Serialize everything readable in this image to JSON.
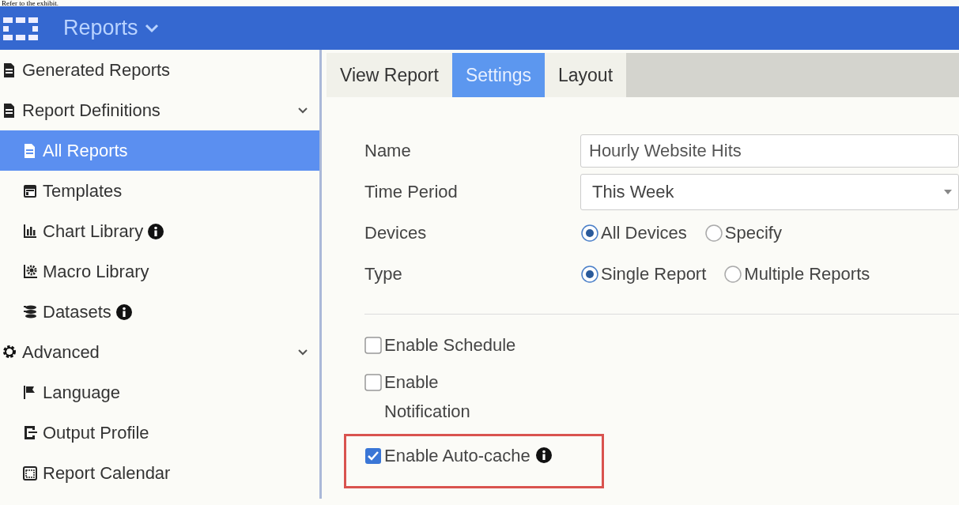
{
  "caption": "Refer to the exhibit.",
  "header": {
    "title": "Reports"
  },
  "sidebar": {
    "items": [
      {
        "label": "Generated Reports",
        "kind": "doc",
        "info": false,
        "selected": false
      },
      {
        "label": "Report Definitions",
        "kind": "doc",
        "info": false,
        "selected": false,
        "expanded": true,
        "children": [
          {
            "label": "All Reports",
            "kind": "report",
            "info": false,
            "selected": true
          },
          {
            "label": "Templates",
            "kind": "template",
            "info": false,
            "selected": false
          },
          {
            "label": "Chart Library",
            "kind": "chart",
            "info": true,
            "selected": false
          },
          {
            "label": "Macro Library",
            "kind": "macro",
            "info": false,
            "selected": false
          },
          {
            "label": "Datasets",
            "kind": "dataset",
            "info": true,
            "selected": false
          }
        ]
      },
      {
        "label": "Advanced",
        "kind": "gear",
        "info": false,
        "selected": false,
        "expanded": true,
        "children": [
          {
            "label": "Language",
            "kind": "flag",
            "info": false,
            "selected": false
          },
          {
            "label": "Output Profile",
            "kind": "output",
            "info": false,
            "selected": false
          },
          {
            "label": "Report Calendar",
            "kind": "calendar",
            "info": false,
            "selected": false
          }
        ]
      }
    ]
  },
  "tabs": [
    {
      "label": "View Report",
      "selected": false
    },
    {
      "label": "Settings",
      "selected": true
    },
    {
      "label": "Layout",
      "selected": false
    }
  ],
  "form": {
    "fields": [
      {
        "label": "Name",
        "kind": "text",
        "value": "Hourly Website Hits"
      },
      {
        "label": "Time Period",
        "kind": "select",
        "value": "This Week"
      },
      {
        "label": "Devices",
        "kind": "radio",
        "options": [
          {
            "label": "All Devices",
            "selected": true
          },
          {
            "label": "Specify",
            "selected": false
          }
        ]
      },
      {
        "label": "Type",
        "kind": "radio",
        "options": [
          {
            "label": "Single Report",
            "selected": true
          },
          {
            "label": "Multiple Reports",
            "selected": false
          }
        ]
      }
    ],
    "checkboxes": [
      {
        "label": "Enable Schedule",
        "checked": false,
        "info": false,
        "highlighted": false
      },
      {
        "label": "Enable Notification",
        "checked": false,
        "info": false,
        "highlighted": false
      },
      {
        "label": "Enable Auto-cache",
        "checked": true,
        "info": true,
        "highlighted": true
      }
    ]
  }
}
